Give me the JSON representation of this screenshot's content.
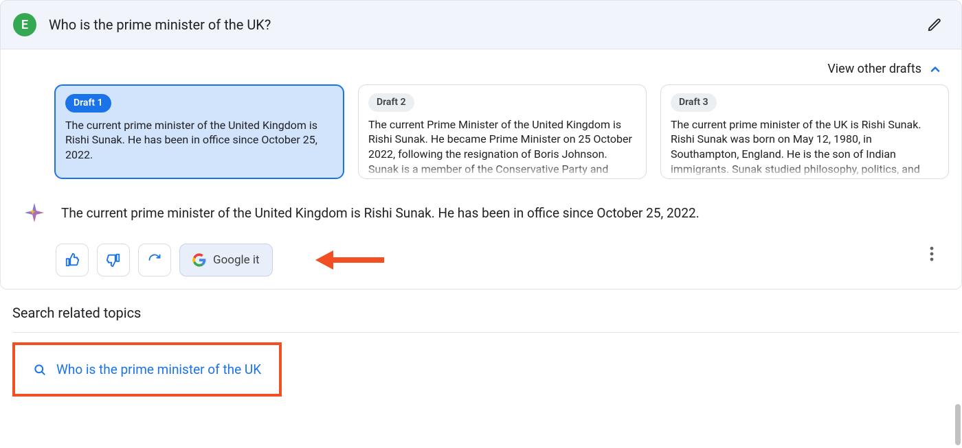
{
  "colors": {
    "accent": "#1a73e8",
    "avatar_bg": "#34a853",
    "annotation": "#f25022"
  },
  "prompt": {
    "avatar_letter": "E",
    "text": "Who is the prime minister of the UK?"
  },
  "drafts_header": {
    "label": "View other drafts"
  },
  "drafts": [
    {
      "chip": "Draft 1",
      "body": "The current prime minister of the United Kingdom is Rishi Sunak. He has been in office since October 25, 2022.",
      "selected": true
    },
    {
      "chip": "Draft 2",
      "body": "The current Prime Minister of the United Kingdom is Rishi Sunak. He became Prime Minister on 25 October 2022, following the resignation of Boris Johnson. Sunak is a member of the Conservative Party and represents the Richmond (Yorks)",
      "selected": false
    },
    {
      "chip": "Draft 3",
      "body": "The current prime minister of the UK is Rishi Sunak.\n\nRishi Sunak was born on May 12, 1980, in Southampton, England. He is the son of Indian immigrants. Sunak studied philosophy, politics, and",
      "selected": false
    }
  ],
  "answer": {
    "text": "The current prime minister of the United Kingdom is Rishi Sunak. He has been in office since October 25, 2022."
  },
  "actions": {
    "google_it_label": "Google it"
  },
  "related": {
    "heading": "Search related topics",
    "link_text": "Who is the prime minister of the UK"
  }
}
